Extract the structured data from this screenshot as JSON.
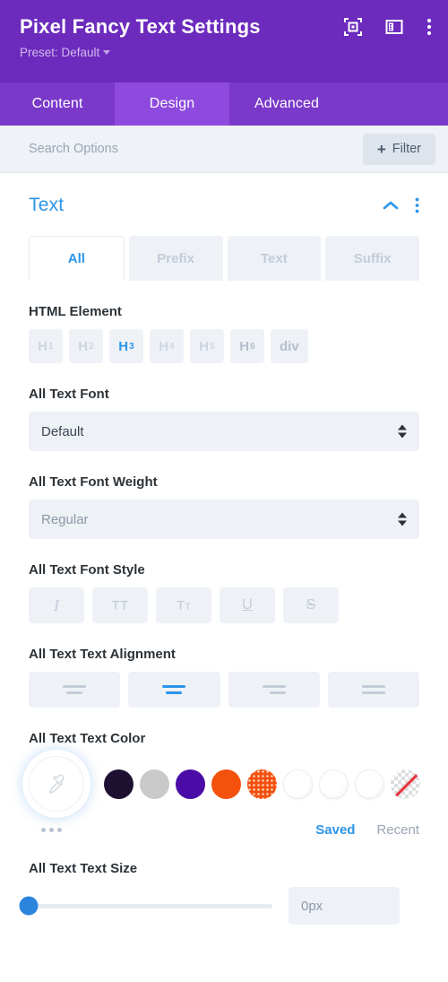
{
  "header": {
    "title": "Pixel Fancy Text Settings",
    "preset_label": "Preset: Default",
    "icons": [
      "focus-icon",
      "layout-panel-icon",
      "more-vertical-icon"
    ],
    "background": "#6c2bbd"
  },
  "tabs": [
    {
      "label": "Content",
      "active": false
    },
    {
      "label": "Design",
      "active": true
    },
    {
      "label": "Advanced",
      "active": false
    }
  ],
  "search": {
    "placeholder": "Search Options",
    "value": "",
    "filter_label": "Filter",
    "filter_plus": "+"
  },
  "section": {
    "title": "Text",
    "collapse_icon": "chevron-up-icon",
    "more_icon": "more-vertical-icon",
    "accent": "#2b95e9"
  },
  "subtabs": [
    {
      "label": "All",
      "active": true
    },
    {
      "label": "Prefix",
      "active": false
    },
    {
      "label": "Text",
      "active": false
    },
    {
      "label": "Suffix",
      "active": false
    }
  ],
  "html_element": {
    "label": "HTML Element",
    "options": [
      {
        "tag": "H",
        "sub": "1",
        "active": false
      },
      {
        "tag": "H",
        "sub": "2",
        "active": false
      },
      {
        "tag": "H",
        "sub": "3",
        "active": true
      },
      {
        "tag": "H",
        "sub": "4",
        "active": false
      },
      {
        "tag": "H",
        "sub": "5",
        "active": false
      },
      {
        "tag": "H",
        "sub": "6",
        "active": false
      },
      {
        "tag": "div",
        "sub": "",
        "active": false
      }
    ]
  },
  "font": {
    "label": "All Text Font",
    "value": "Default"
  },
  "font_weight": {
    "label": "All Text Font Weight",
    "value": "Regular"
  },
  "font_style": {
    "label": "All Text Font Style",
    "options": [
      {
        "name": "italic",
        "glyph": "I"
      },
      {
        "name": "uppercase",
        "glyph": "TT"
      },
      {
        "name": "small-caps",
        "glyph": "T",
        "glyph_small": "T"
      },
      {
        "name": "underline",
        "glyph": "U"
      },
      {
        "name": "strikethrough",
        "glyph": "S"
      }
    ]
  },
  "text_alignment": {
    "label": "All Text Text Alignment",
    "options": [
      {
        "name": "align-left",
        "active": false
      },
      {
        "name": "align-center",
        "active": true
      },
      {
        "name": "align-right",
        "active": false
      },
      {
        "name": "align-justify",
        "active": false
      }
    ]
  },
  "text_color": {
    "label": "All Text Text Color",
    "eyedropper": "eyedropper-icon",
    "swatches": [
      {
        "name": "swatch-dark-navy",
        "color": "#1e1030",
        "type": "solid"
      },
      {
        "name": "swatch-light-gray",
        "color": "#c9c9c9",
        "type": "solid"
      },
      {
        "name": "swatch-purple",
        "color": "#4b0ba6",
        "type": "solid"
      },
      {
        "name": "swatch-orange",
        "color": "#f4510e",
        "type": "solid"
      },
      {
        "name": "swatch-orange-gradient",
        "color": "#f4510e",
        "type": "gradient"
      },
      {
        "name": "swatch-empty-1",
        "color": "#ffffff",
        "type": "empty"
      },
      {
        "name": "swatch-empty-2",
        "color": "#ffffff",
        "type": "empty"
      },
      {
        "name": "swatch-empty-3",
        "color": "#ffffff",
        "type": "empty"
      },
      {
        "name": "swatch-transparent",
        "color": "transparent",
        "type": "none"
      }
    ],
    "more_icon": "more-horizontal-icon",
    "tabs": [
      {
        "label": "Saved",
        "active": true
      },
      {
        "label": "Recent",
        "active": false
      }
    ]
  },
  "text_size": {
    "label": "All Text Text Size",
    "value": "0px",
    "slider_percent": 0
  }
}
